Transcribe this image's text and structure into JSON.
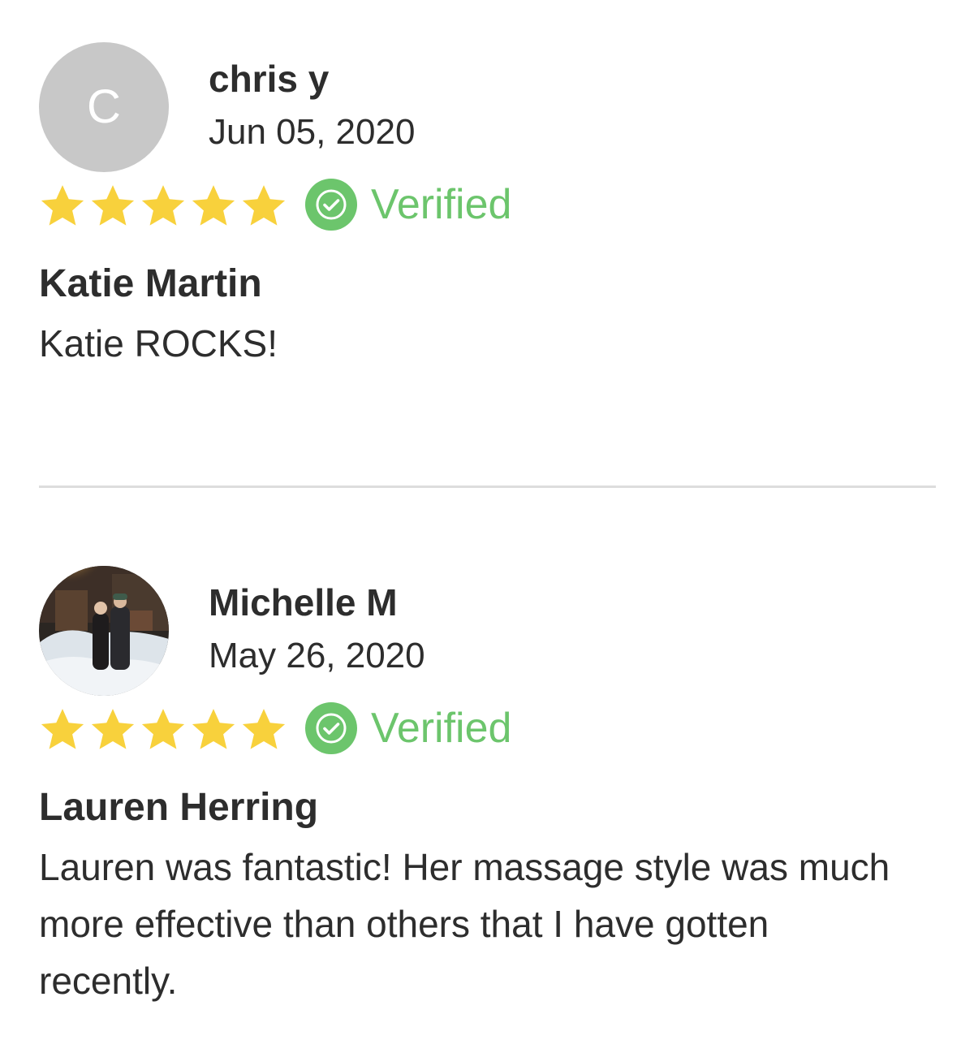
{
  "colors": {
    "star": "#f8d13c",
    "verified": "#6cc56c",
    "avatar_placeholder": "#c8c8c8",
    "divider": "#dddddd"
  },
  "reviews": [
    {
      "avatar_letter": "C",
      "author": "chris y",
      "date": "Jun 05, 2020",
      "rating": 5,
      "verified_label": "Verified",
      "provider": "Katie Martin",
      "comment": "Katie ROCKS!"
    },
    {
      "avatar_letter": "",
      "avatar_photo": "photo of two people in snow",
      "author": "Michelle M",
      "date": "May 26, 2020",
      "rating": 5,
      "verified_label": "Verified",
      "provider": "Lauren Herring",
      "comment": "Lauren was fantastic! Her massage style was much more effective than others that I have gotten recently."
    }
  ]
}
